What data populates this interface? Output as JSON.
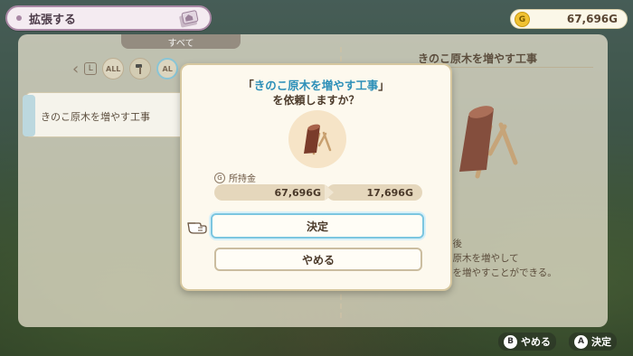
{
  "header": {
    "title": "拡張する"
  },
  "money": {
    "coin_letter": "G",
    "amount": "67,696G"
  },
  "background_panel": {
    "tab_label": "すべて",
    "shoulder_key": "L",
    "categories": [
      "ALL",
      "AL"
    ],
    "list": [
      {
        "label": "きのこ原木を増やす工事"
      }
    ],
    "detail_title": "きのこ原木を増やす工事",
    "description_lines": [
      "日後",
      "る原木を増やして",
      "こを増やすことができる。"
    ]
  },
  "dialog": {
    "question_prefix": "「",
    "question_highlight": "きのこ原木を増やす工事",
    "question_suffix": "」",
    "question_line2": "を依頼しますか？",
    "funds_label": "所持金",
    "funds_icon_letter": "G",
    "balance_before": "67,696G",
    "balance_after": "17,696G",
    "confirm_label": "決定",
    "cancel_label": "やめる"
  },
  "hints": [
    {
      "button": "B",
      "label": "やめる"
    },
    {
      "button": "A",
      "label": "決定"
    }
  ],
  "colors": {
    "accent_blue": "#2c8fb8",
    "gold": "#f1c232",
    "panel": "#f0e9d6"
  }
}
